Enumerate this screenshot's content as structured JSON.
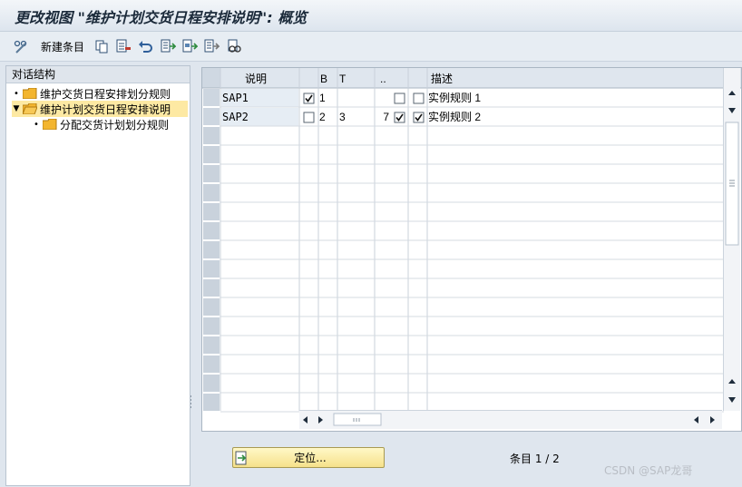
{
  "window": {
    "title": "更改视图 \"维护计划交货日程安排说明\": 概览"
  },
  "toolbar": {
    "items": [
      {
        "name": "display-change-icon",
        "label": ""
      },
      {
        "name": "new-entries-button",
        "label": "新建条目"
      },
      {
        "name": "copy-icon",
        "label": ""
      },
      {
        "name": "delete-icon",
        "label": ""
      },
      {
        "name": "undo-icon",
        "label": ""
      },
      {
        "name": "select-all-icon",
        "label": ""
      },
      {
        "name": "select-block-icon",
        "label": ""
      },
      {
        "name": "deselect-all-icon",
        "label": ""
      },
      {
        "name": "find-icon",
        "label": ""
      }
    ]
  },
  "tree": {
    "header": "对话结构",
    "nodes": [
      {
        "label": "维护交货日程安排划分规则",
        "selected": false,
        "open": false,
        "level": 0
      },
      {
        "label": "维护计划交货日程安排说明",
        "selected": true,
        "open": true,
        "level": 0
      },
      {
        "label": "分配交货计划划分规则",
        "selected": false,
        "open": false,
        "level": 1
      }
    ]
  },
  "table": {
    "columns": {
      "desc": "说明",
      "b": "B",
      "t": "T",
      "dots": "..",
      "c1": "",
      "c2": "",
      "text": "描述"
    },
    "rows": [
      {
        "desc": "SAP1",
        "chk_b": true,
        "b": "1",
        "t": "",
        "dots": "",
        "c1": false,
        "c2": false,
        "text": "实例规则 1"
      },
      {
        "desc": "SAP2",
        "chk_b": false,
        "b": "2",
        "t": "3",
        "dots": "7",
        "c1": true,
        "c2": true,
        "text": "实例规则 2"
      }
    ],
    "empty_rows": 15
  },
  "footer": {
    "position_button": "定位...",
    "entry_status": "条目 1 / 2",
    "watermark": "CSDN @SAP龙哥"
  },
  "colors": {
    "selected_node": "#fde9a3",
    "folder": "#f3b52f",
    "position_button": "#f6e18a"
  }
}
